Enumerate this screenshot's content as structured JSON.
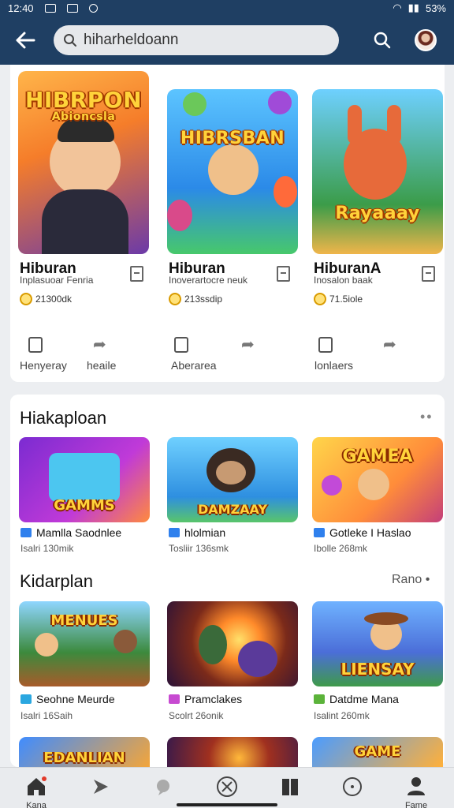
{
  "status": {
    "time": "12:40",
    "battery": "53%"
  },
  "search": {
    "value": "hiharheldoann"
  },
  "featured": [
    {
      "art_text": "HIBRPON",
      "art_subtext": "Abioncsla",
      "title": "Hiburan",
      "subtitle": "Inplasuoar Fenria",
      "meta": "21300dk"
    },
    {
      "art_text": "HIBRSBAN",
      "art_subtext": "",
      "title": "Hiburan",
      "subtitle": "Inoverartocre neuk",
      "meta": "213ssdip"
    },
    {
      "art_text": "Rayaaay",
      "art_subtext": "",
      "title": "HiburanA",
      "subtitle": "Inosalon baak",
      "meta": "71.5iole"
    }
  ],
  "actions": [
    "Henyeray",
    "heaile",
    "Aberarea",
    "lonlaers"
  ],
  "section1": {
    "title": "Hiakaploan",
    "items": [
      {
        "art_text": "GAMMS",
        "title": "Mamlla Saodnlee",
        "subtitle": "Isalri 130mik",
        "badge_color": "#2f80ed"
      },
      {
        "art_text": "DAMZAAY",
        "title": "hlolmian",
        "subtitle": "Tosliir 136smk",
        "badge_color": "#2f80ed"
      },
      {
        "art_text": "GAMEA",
        "title": "Gotleke I Haslao",
        "subtitle": "Ibolle 268mk",
        "badge_color": "#2f80ed"
      }
    ]
  },
  "section2": {
    "title": "Kidarplan",
    "more": "Rano",
    "items": [
      {
        "art_text": "MENUES",
        "title": "Seohne Meurde",
        "subtitle": "Isalri 16Saih",
        "badge_color": "#2aa7e0"
      },
      {
        "art_text": "",
        "title": "Pramclakes",
        "subtitle": "Scolrt 26onik",
        "badge_color": "#c74ad1"
      },
      {
        "art_text": "LIENSAY",
        "title": "Datdme Mana",
        "subtitle": "Isalint 260mk",
        "badge_color": "#5bb33a"
      }
    ],
    "peek": [
      {
        "art_text": "EDANLIAN"
      },
      {
        "art_text": ""
      },
      {
        "art_text": "GAME"
      }
    ]
  },
  "nav": {
    "left_label": "Kana",
    "right_label": "Fame"
  },
  "icons": [
    "back-arrow-icon",
    "search-icon",
    "bookmark-icon",
    "coin-icon",
    "share-icon",
    "home-icon",
    "play-icon",
    "chat-icon",
    "close-circle-icon",
    "book-icon",
    "compass-icon",
    "person-icon"
  ]
}
